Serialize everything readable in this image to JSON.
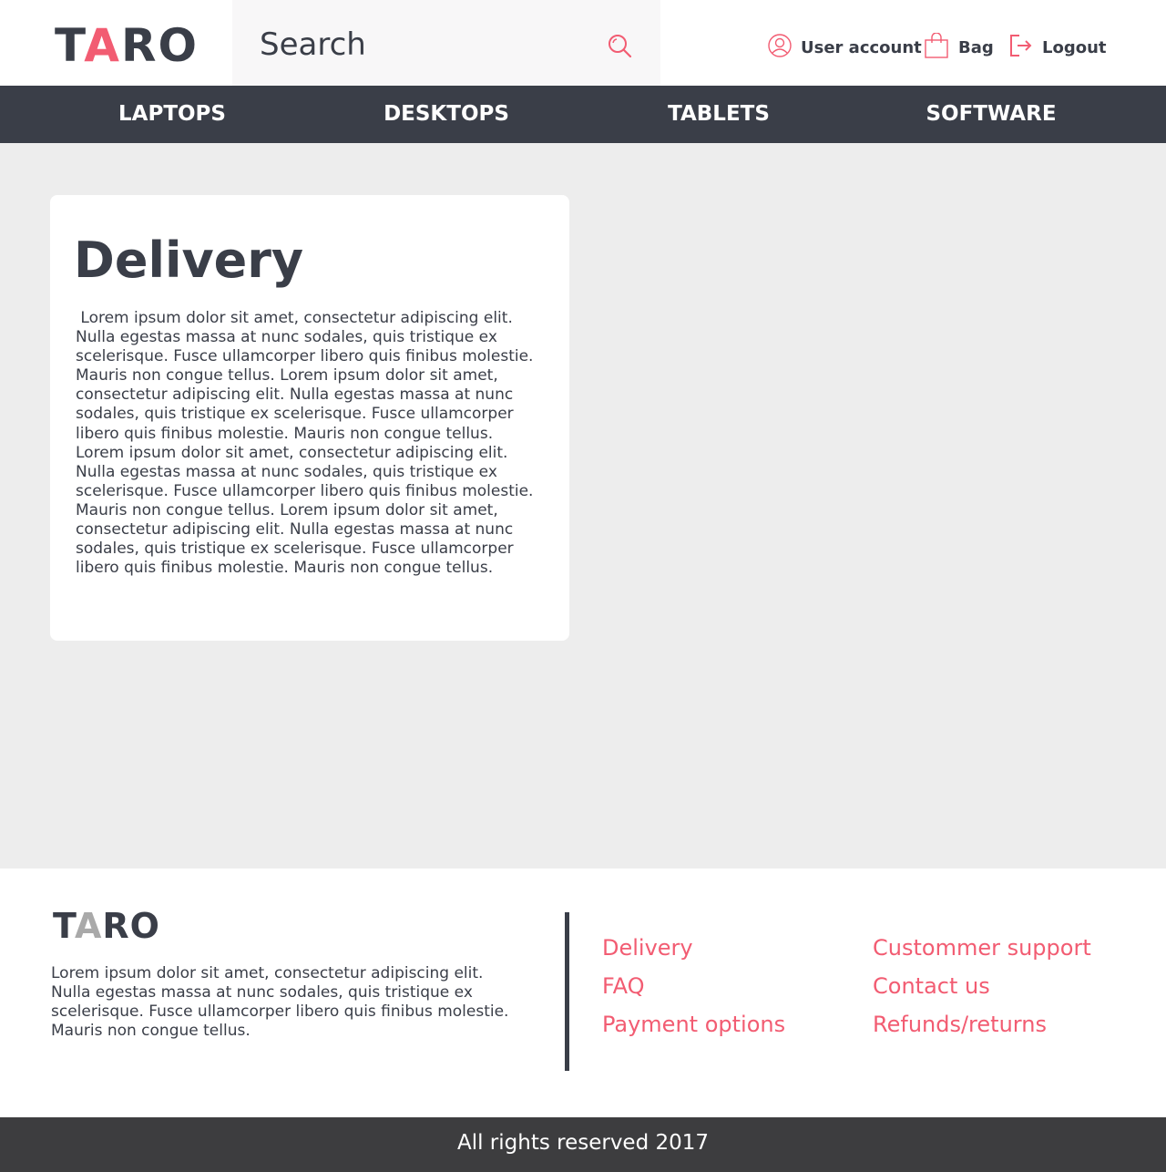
{
  "header": {
    "logo": {
      "first": "T",
      "accent": "A",
      "rest": "RO"
    },
    "search_placeholder": "Search",
    "user_account": "User account",
    "bag": "Bag",
    "logout": "Logout"
  },
  "nav": {
    "items": [
      {
        "label": "LAPTOPS"
      },
      {
        "label": "DESKTOPS"
      },
      {
        "label": "TABLETS"
      },
      {
        "label": "SOFTWARE"
      }
    ]
  },
  "main": {
    "title": "Delivery",
    "body": " Lorem ipsum dolor sit amet, consectetur adipiscing elit.\nNulla egestas massa at nunc sodales, quis tristique ex\nscelerisque. Fusce ullamcorper libero quis finibus molestie.\nMauris non congue tellus. Lorem ipsum dolor sit amet,\nconsectetur adipiscing elit. Nulla egestas massa at nunc\nsodales, quis tristique ex scelerisque. Fusce ullamcorper\nlibero quis finibus molestie. Mauris non congue tellus.\nLorem ipsum dolor sit amet, consectetur adipiscing elit.\nNulla egestas massa at nunc sodales, quis tristique ex\nscelerisque. Fusce ullamcorper libero quis finibus molestie.\nMauris non congue tellus. Lorem ipsum dolor sit amet,\nconsectetur adipiscing elit. Nulla egestas massa at nunc\nsodales, quis tristique ex scelerisque. Fusce ullamcorper\nlibero quis finibus molestie. Mauris non congue tellus."
  },
  "footer": {
    "logo": {
      "first": "T",
      "accent": "A",
      "rest": "RO"
    },
    "text": "Lorem ipsum dolor sit amet, consectetur adipiscing elit. Nulla egestas massa at nunc sodales, quis tristique ex scelerisque. Fusce ullamcorper libero quis finibus molestie. Mauris non congue tellus.",
    "links": [
      {
        "label": "Delivery"
      },
      {
        "label": "FAQ"
      },
      {
        "label": "Payment options"
      },
      {
        "label": "Custommer support"
      },
      {
        "label": "Contact us"
      },
      {
        "label": "Refunds/returns"
      }
    ],
    "copyright": "All rights reserved 2017"
  },
  "colors": {
    "accent": "#f25c72",
    "dark": "#3a3e48",
    "background": "#ededed"
  },
  "icons": [
    "search-icon",
    "user-icon",
    "bag-icon",
    "logout-icon"
  ]
}
